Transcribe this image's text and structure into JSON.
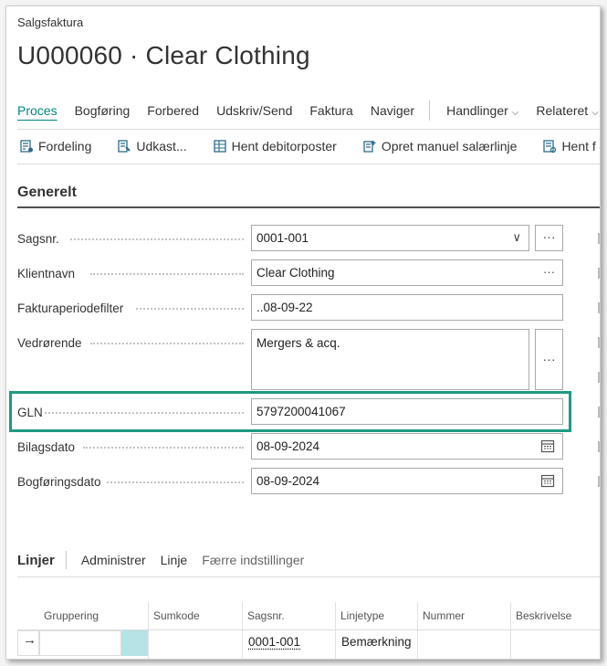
{
  "breadcrumb": "Salgsfaktura",
  "page_title": "U000060 · Clear Clothing",
  "menu": {
    "items": [
      "Proces",
      "Bogføring",
      "Forbered",
      "Udskriv/Send",
      "Faktura",
      "Naviger"
    ],
    "dropdowns": [
      "Handlinger",
      "Relateret"
    ],
    "active": "Proces"
  },
  "actions": [
    "Fordeling",
    "Udkast...",
    "Hent debitorposter",
    "Opret manuel salærlinje",
    "Hent f"
  ],
  "section_title": "Generelt",
  "fields": {
    "sagsnr": {
      "label": "Sagsnr.",
      "value": "0001-001",
      "lookup": "···"
    },
    "klientnavn": {
      "label": "Klientnavn",
      "value": "Clear Clothing",
      "lookup": "···"
    },
    "fakturaperiodefilter": {
      "label": "Fakturaperiodefilter",
      "value": "..08-09-22"
    },
    "vedrorende": {
      "label": "Vedrørende",
      "value": "Mergers & acq.",
      "lookup": "···"
    },
    "gln": {
      "label": "GLN",
      "value": "5797200041067"
    },
    "bilagsdato": {
      "label": "Bilagsdato",
      "value": "08-09-2024"
    },
    "bogforingsdato": {
      "label": "Bogføringsdato",
      "value": "08-09-2024"
    }
  },
  "lines": {
    "title": "Linjer",
    "actions": [
      "Administrer",
      "Linje",
      "Færre indstillinger"
    ],
    "columns": [
      "Gruppering",
      "Sumkode",
      "Sagsnr.",
      "Linjetype",
      "Nummer",
      "Beskrivelse"
    ],
    "rows": [
      {
        "sagsnr": "0001-001",
        "linjetype": "Bemærkning"
      }
    ]
  },
  "colors": {
    "accent": "#00857c",
    "highlight_border": "#1e9a82",
    "selected_cell": "#b6e3e6"
  }
}
